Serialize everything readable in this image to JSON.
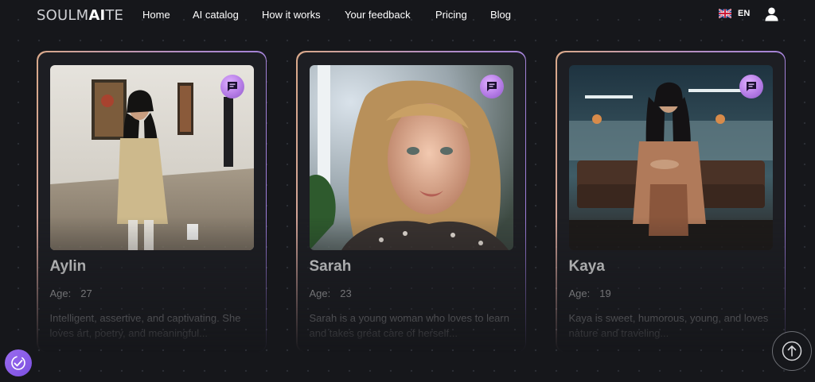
{
  "header": {
    "logo_regular": "SOULM",
    "logo_bold": "AI",
    "logo_tail": "TE",
    "nav": [
      "Home",
      "AI catalog",
      "How it works",
      "Your feedback",
      "Pricing",
      "Blog"
    ],
    "language": "EN"
  },
  "cards": [
    {
      "name": "Aylin",
      "age_label": "Age:",
      "age": "27",
      "description": "Intelligent, assertive, and captivating. She loves art, poetry, and meaningful..."
    },
    {
      "name": "Sarah",
      "age_label": "Age:",
      "age": "23",
      "description": "Sarah is a young woman who loves to learn and takes great care of herself..."
    },
    {
      "name": "Kaya",
      "age_label": "Age:",
      "age": "19",
      "description": "Kaya is sweet, humorous, young, and loves nature and traveling..."
    }
  ],
  "colors": {
    "background": "#16171b",
    "card_bg": "#1d1e23",
    "accent_purple": "#b57ce6",
    "border_gradient_start": "#d9a98a",
    "border_gradient_end": "#9a7be0"
  },
  "icons": {
    "chat": "chat-bubble-icon",
    "user": "user-icon",
    "flag": "uk-flag-icon",
    "scroll_top": "arrow-up-icon",
    "widget": "badge-check-icon"
  }
}
